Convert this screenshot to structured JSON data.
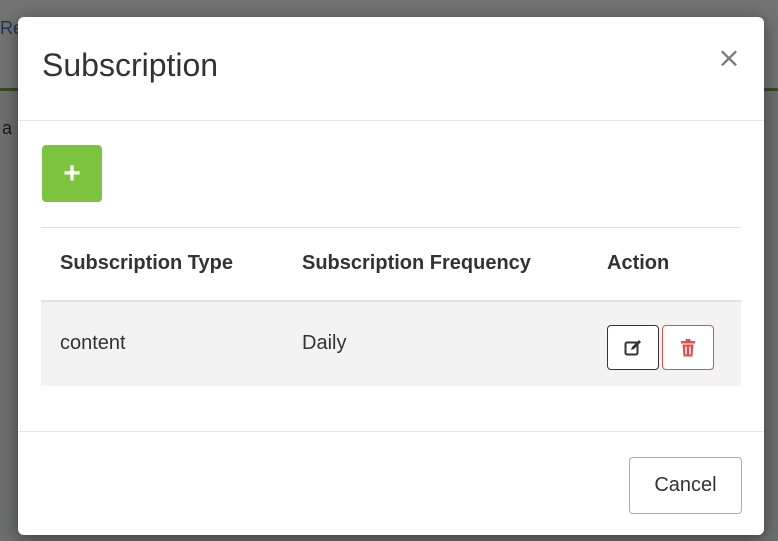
{
  "background": {
    "link_fragment": "Re",
    "text_fragment": "a"
  },
  "modal": {
    "title": "Subscription",
    "close_symbol": "×",
    "add_button_symbol": "+",
    "table": {
      "headers": [
        "Subscription Type",
        "Subscription Frequency",
        "Action"
      ],
      "rows": [
        {
          "type": "content",
          "frequency": "Daily"
        }
      ]
    },
    "cancel_label": "Cancel"
  },
  "icons": {
    "edit": "edit-icon",
    "delete": "trash-icon",
    "close": "close-icon",
    "add": "plus-icon"
  },
  "colors": {
    "add_button": "#7dc33f",
    "delete_border": "#d9534f",
    "delete_icon": "#d9534f"
  }
}
